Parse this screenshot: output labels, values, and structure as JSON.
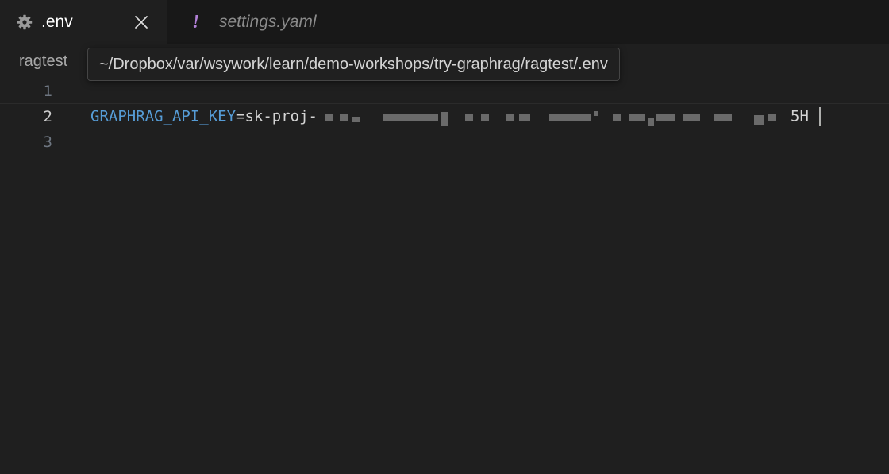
{
  "tabs": [
    {
      "label": ".env",
      "icon": "gear-icon",
      "active": true,
      "close_glyph": "✕"
    },
    {
      "label": "settings.yaml",
      "icon": "exclamation-icon",
      "icon_glyph": "!",
      "active": false
    }
  ],
  "breadcrumb": {
    "folder": "ragtest"
  },
  "tooltip": {
    "path": "~/Dropbox/var/wsywork/learn/demo-workshops/try-graphrag/ragtest/.env"
  },
  "editor": {
    "lines": [
      {
        "number": "1",
        "text": ""
      },
      {
        "number": "2",
        "key": "GRAPHRAG_API_KEY",
        "eq": "=",
        "value_prefix": "sk-proj-",
        "value_suffix": "5H",
        "redacted": true
      },
      {
        "number": "3",
        "text": ""
      }
    ]
  },
  "colors": {
    "background": "#1f1f1f",
    "tabbar": "#181818",
    "key": "#569cd6",
    "yaml_icon": "#b180d7"
  }
}
